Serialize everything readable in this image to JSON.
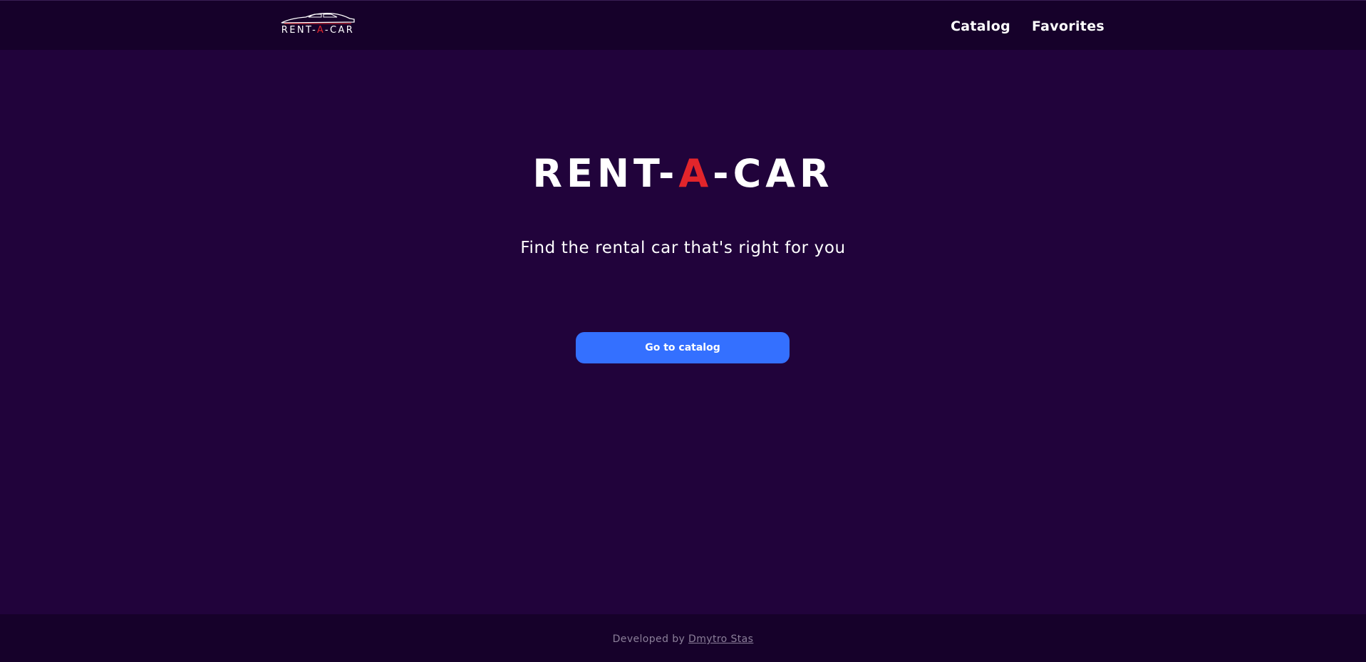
{
  "header": {
    "logo": {
      "text_before": "RENT-",
      "text_accent": "A",
      "text_after": "-CAR",
      "icon": "car-silhouette-icon"
    },
    "nav": {
      "catalog": "Catalog",
      "favorites": "Favorites"
    }
  },
  "hero": {
    "title_before": "RENT-",
    "title_accent": "A",
    "title_after": "-CAR",
    "subtitle": "Find the rental car that's right for you",
    "cta_label": "Go to catalog"
  },
  "footer": {
    "prefix": "Developed by",
    "author": "Dmytro Stas"
  },
  "colors": {
    "background": "#21033b",
    "header_footer": "#16012a",
    "accent_red": "#e2252b",
    "button_blue": "#3470ff",
    "footer_text": "#8b7f99"
  }
}
